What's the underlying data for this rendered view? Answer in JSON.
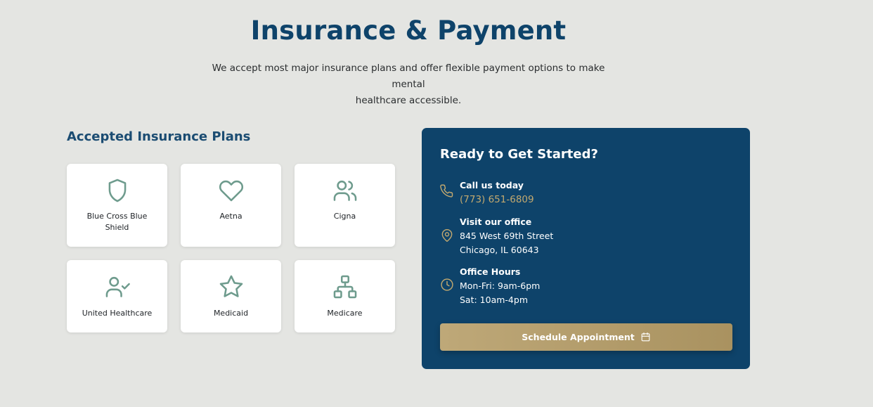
{
  "header": {
    "title": "Insurance & Payment",
    "subtitle_line1": "We accept most major insurance plans and offer flexible payment options to make mental",
    "subtitle_line2": "healthcare accessible."
  },
  "plans": {
    "heading": "Accepted Insurance Plans",
    "items": [
      {
        "label_line1": "Blue Cross Blue",
        "label_line2": "Shield",
        "icon": "shield-icon"
      },
      {
        "label_line1": "Aetna",
        "label_line2": "",
        "icon": "heart-icon"
      },
      {
        "label_line1": "Cigna",
        "label_line2": "",
        "icon": "users-icon"
      },
      {
        "label_line1": "United Healthcare",
        "label_line2": "",
        "icon": "user-check-icon"
      },
      {
        "label_line1": "Medicaid",
        "label_line2": "",
        "icon": "star-icon"
      },
      {
        "label_line1": "Medicare",
        "label_line2": "",
        "icon": "network-icon"
      }
    ]
  },
  "contact": {
    "title": "Ready to Get Started?",
    "call": {
      "label": "Call us today",
      "value": "(773) 651-6809",
      "icon": "phone-icon"
    },
    "office": {
      "label": "Visit our office",
      "line1": "845 West 69th Street",
      "line2": "Chicago, IL 60643",
      "icon": "map-pin-icon"
    },
    "hours": {
      "label": "Office Hours",
      "line1": "Mon-Fri: 9am-6pm",
      "line2": "Sat: 10am-4pm",
      "icon": "clock-icon"
    },
    "cta_label": "Schedule Appointment",
    "cta_icon": "calendar-icon"
  },
  "colors": {
    "background": "#e4e5e2",
    "primary": "#0e436a",
    "accent_gold": "#c3a96f",
    "icon_green": "#6e9b8d"
  }
}
